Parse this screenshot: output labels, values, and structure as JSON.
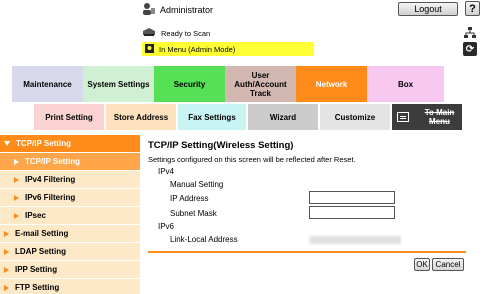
{
  "header": {
    "user": "Administrator",
    "logout_label": "Logout",
    "help_label": "?",
    "status": "Ready to Scan",
    "mode": "In Menu (Admin Mode)"
  },
  "main_tabs": [
    {
      "label": "Maintenance",
      "color": "#d8d8ec"
    },
    {
      "label": "System Settings",
      "color": "#cff0d2"
    },
    {
      "label": "Security",
      "color": "#55e055"
    },
    {
      "label": "User Auth/Account Track",
      "color": "#d2b8b0"
    },
    {
      "label": "Network",
      "color": "#ff8c1a"
    },
    {
      "label": "Box",
      "color": "#f8c8f0"
    }
  ],
  "sub_tabs": [
    {
      "label": "Print Setting",
      "color": "#fbd3d3"
    },
    {
      "label": "Store Address",
      "color": "#fde2be"
    },
    {
      "label": "Fax Settings",
      "color": "#c8f4f4"
    },
    {
      "label": "Wizard",
      "color": "#cccccc"
    },
    {
      "label": "Customize",
      "color": "#e4e4e4"
    },
    {
      "label": "To Main Menu",
      "color": "#3c3c3c"
    }
  ],
  "sidebar": {
    "section": "TCP/IP Setting",
    "sub_items": [
      "TCP/IP Setting",
      "IPv4 Filtering",
      "IPv6 Filtering",
      "IPsec"
    ],
    "categories": [
      "E-mail Setting",
      "LDAP Setting",
      "IPP Setting",
      "FTP Setting"
    ]
  },
  "content": {
    "title": "TCP/IP Setting(Wireless Setting)",
    "notice": "Settings configured on this screen will be reflected after Reset.",
    "ipv4_label": "IPv4",
    "manual_setting": "Manual Setting",
    "ip_address_label": "IP Address",
    "subnet_mask_label": "Subnet Mask",
    "ipv6_label": "IPv6",
    "link_local_label": "Link-Local Address",
    "ip_address_value": "",
    "subnet_mask_value": ""
  },
  "buttons": {
    "ok": "OK",
    "cancel": "Cancel"
  },
  "colors": {
    "accent": "#ff8c1a",
    "mode_bg": "#ffff33",
    "sidebar_light": "#fde9c8"
  }
}
